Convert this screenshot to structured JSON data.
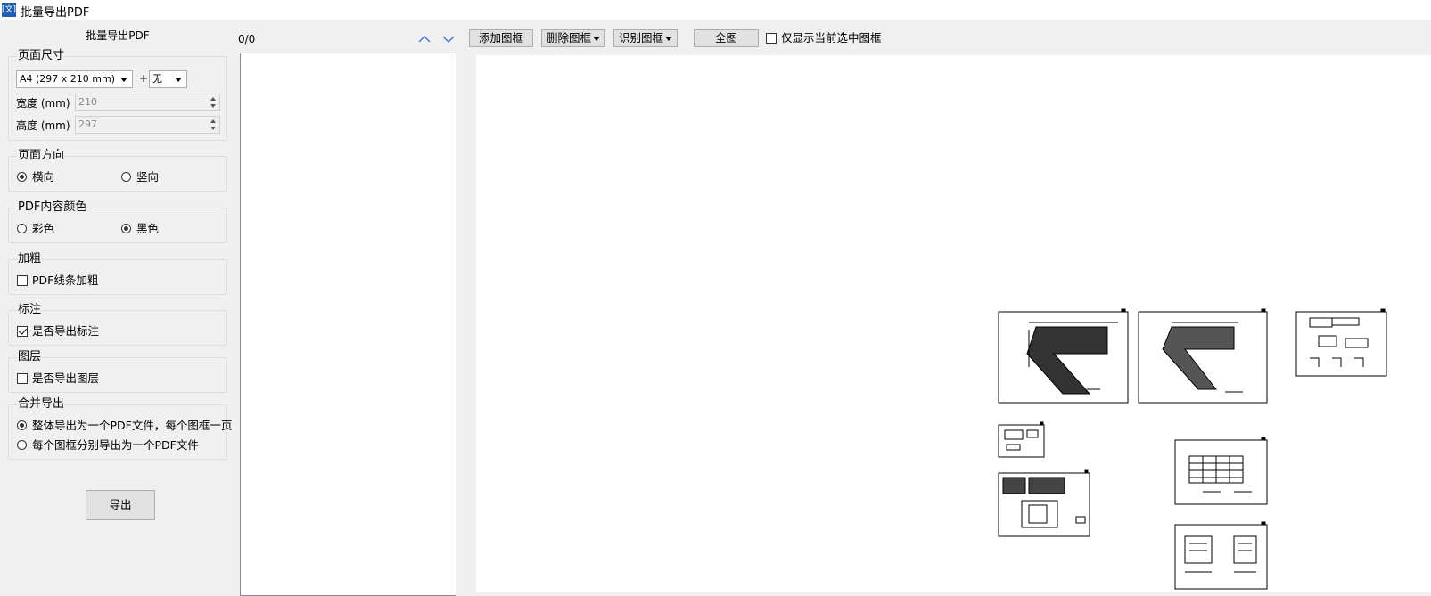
{
  "window": {
    "icon_text": "[文]",
    "title": "批量导出PDF"
  },
  "panel": {
    "title": "批量导出PDF"
  },
  "page_size": {
    "legend": "页面尺寸",
    "size_selected": "A4 (297 x 210 mm)",
    "plus": "+",
    "extra_selected": "无",
    "width_label": "宽度 (mm)",
    "width_value": "210",
    "height_label": "高度 (mm)",
    "height_value": "297"
  },
  "orientation": {
    "legend": "页面方向",
    "landscape": "横向",
    "portrait": "竖向",
    "selected": "landscape"
  },
  "color": {
    "legend": "PDF内容颜色",
    "color_opt": "彩色",
    "black_opt": "黑色",
    "selected": "black"
  },
  "bold": {
    "legend": "加粗",
    "label": "PDF线条加粗",
    "checked": false
  },
  "annotation": {
    "legend": "标注",
    "label": "是否导出标注",
    "checked": true
  },
  "layers": {
    "legend": "图层",
    "label": "是否导出图层",
    "checked": false
  },
  "merge": {
    "legend": "合并导出",
    "option1": "整体导出为一个PDF文件，每个图框一页",
    "option2": "每个图框分别导出为一个PDF文件",
    "selected": "option1"
  },
  "export_button": "导出",
  "list": {
    "counter": "0/0"
  },
  "toolbar": {
    "add_frame": "添加图框",
    "delete_frame": "删除图框",
    "detect_frame": "识别图框",
    "full_view": "全图",
    "show_selected_only": "仅显示当前选中图框"
  },
  "icons": {
    "up": "chevron-up-icon",
    "down": "chevron-down-icon"
  },
  "colors": {
    "accent": "#1e5fb4",
    "panel_bg": "#f0f0f0",
    "canvas_bg": "#ffffff"
  }
}
